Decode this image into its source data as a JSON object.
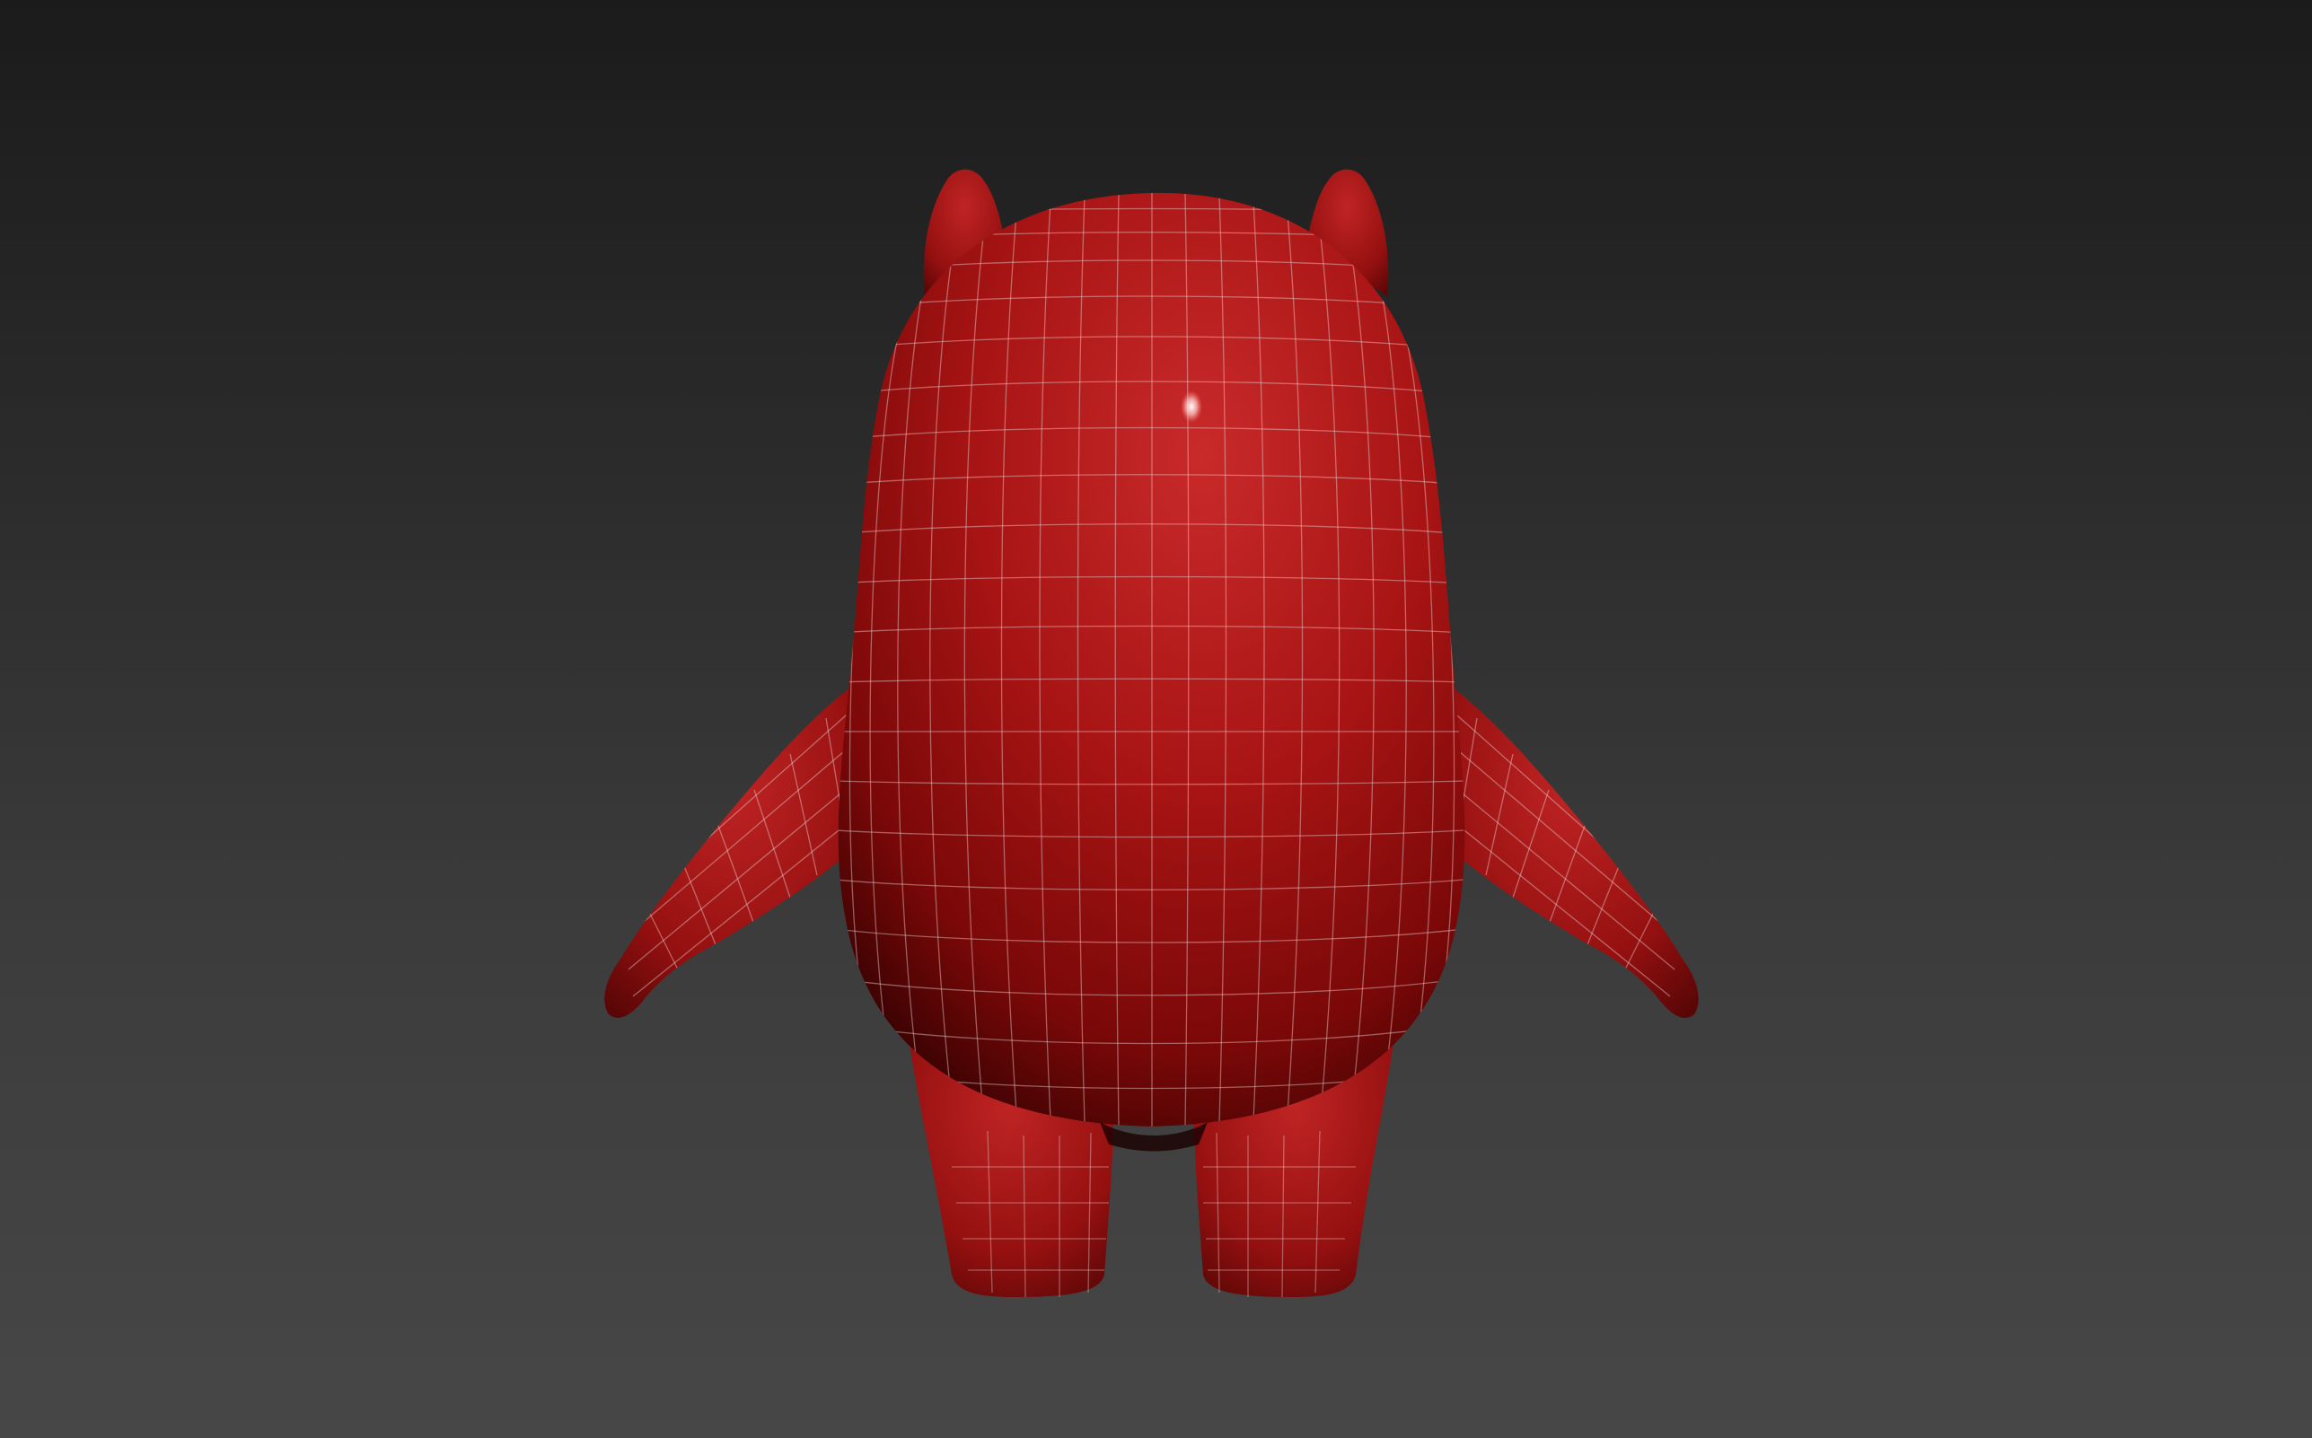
{
  "viewport": {
    "label": "",
    "background": {
      "top": "#1b1b1b",
      "bottom": "#474747"
    }
  },
  "model": {
    "description_icon": "character-mesh-icon",
    "material_color": "#b01a1a",
    "wireframe_color": "#e8d0d0",
    "highlight_color": "#ffffff",
    "wireframe_visible": true
  }
}
